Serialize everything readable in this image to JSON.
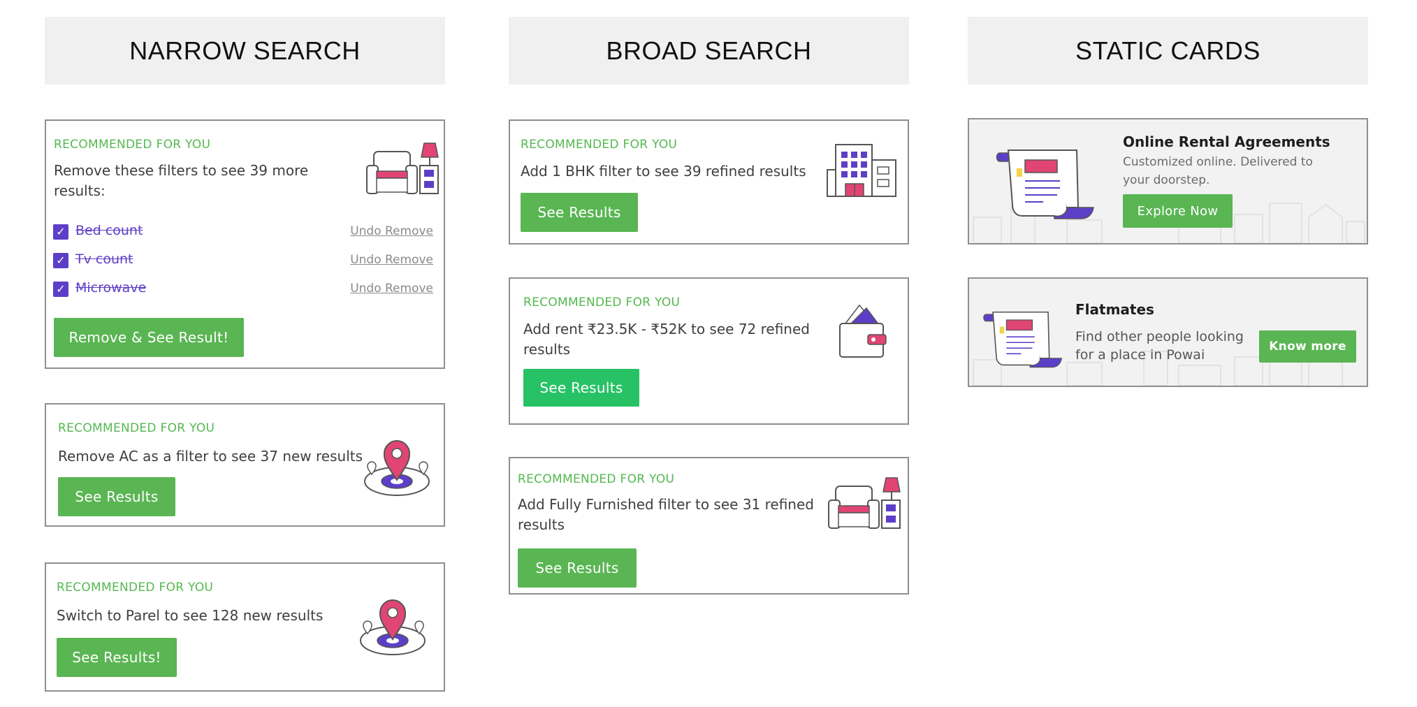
{
  "headers": {
    "narrow": "NARROW SEARCH",
    "broad": "BROAD SEARCH",
    "static": "STATIC CARDS"
  },
  "narrow": {
    "card1": {
      "recommended": "RECOMMENDED FOR YOU",
      "message": "Remove these filters to see 39 more results:",
      "filters": [
        {
          "label": "Bed count",
          "checked": true,
          "undo": "Undo Remove"
        },
        {
          "label": "Tv count",
          "checked": true,
          "undo": "Undo Remove"
        },
        {
          "label": "Microwave",
          "checked": true,
          "undo": "Undo Remove"
        }
      ],
      "button": "Remove & See Result!",
      "icon": "sofa-lamp-icon"
    },
    "card2": {
      "recommended": "RECOMMENDED FOR YOU",
      "message": "Remove AC as a filter to see 37 new results",
      "button": "See Results",
      "icon": "location-pin-icon"
    },
    "card3": {
      "recommended": "RECOMMENDED FOR YOU",
      "message": "Switch to Parel to see 128 new results",
      "button": "See Results!",
      "icon": "location-pin-icon"
    }
  },
  "broad": {
    "card1": {
      "recommended": "RECOMMENDED FOR YOU",
      "message": "Add 1 BHK filter to see 39 refined results",
      "button": "See Results",
      "icon": "building-icon"
    },
    "card2": {
      "recommended": "RECOMMENDED FOR YOU",
      "message": "Add rent ₹23.5K - ₹52K to see 72 refined results",
      "button": "See Results",
      "icon": "wallet-icon"
    },
    "card3": {
      "recommended": "RECOMMENDED FOR YOU",
      "message": "Add Fully Furnished filter to see 31 refined results",
      "button": "See Results",
      "icon": "sofa-lamp-icon"
    }
  },
  "static": {
    "card1": {
      "title": "Online Rental Agreements",
      "description": "Customized online. Delivered to your doorstep.",
      "button": "Explore Now",
      "icon": "document-scroll-icon"
    },
    "card2": {
      "title": "Flatmates",
      "description": "Find other people looking for a place in Powai",
      "button": "Know more",
      "icon": "document-scroll-icon"
    }
  },
  "colors": {
    "accent_green": "#5ab553",
    "bright_green": "#27c266",
    "purple": "#5d3fc7",
    "pink": "#e04574",
    "header_bg": "#f0f0f0"
  }
}
